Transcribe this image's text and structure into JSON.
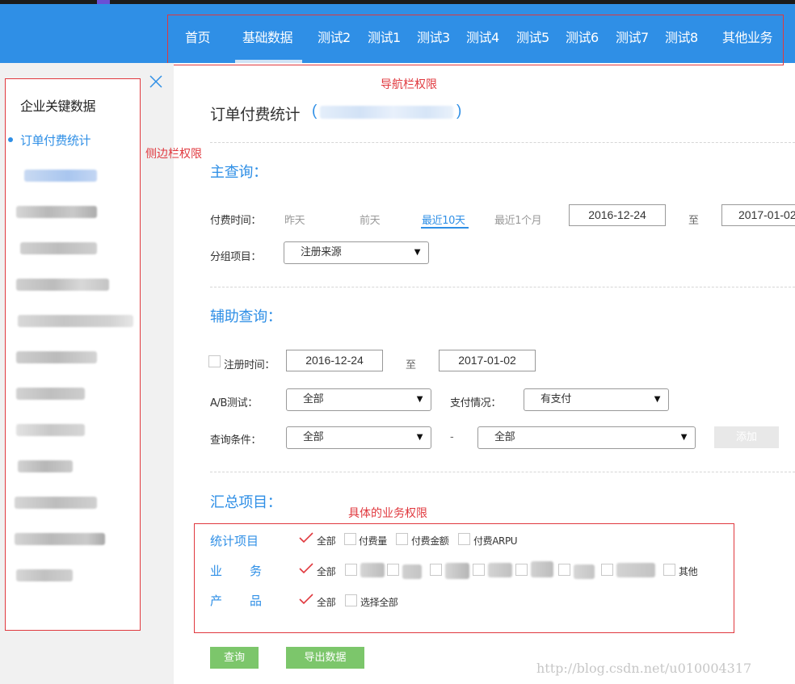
{
  "nav": {
    "items": [
      "首页",
      "基础数据",
      "测试2",
      "测试1",
      "测试3",
      "测试4",
      "测试5",
      "测试6",
      "测试7",
      "测试8",
      "其他业务"
    ],
    "active_index": 1
  },
  "annotations": {
    "nav": "导航栏权限",
    "sidebar": "侧边栏权限",
    "business": "具体的业务权限"
  },
  "sidebar": {
    "title": "企业关键数据",
    "active_item": "订单付费统计"
  },
  "page": {
    "title": "订单付费统计",
    "paren_open": "(",
    "paren_close": ")"
  },
  "main_query": {
    "title": "主查询：",
    "pay_time_label": "付费时间：",
    "quick_ranges": [
      "昨天",
      "前天",
      "最近10天",
      "最近1个月"
    ],
    "active_range": "最近10天",
    "start_date": "2016-12-24",
    "to": "至",
    "end_date": "2017-01-02",
    "group_label": "分组项目：",
    "group_value": "注册来源"
  },
  "aux_query": {
    "title": "辅助查询：",
    "reg_time_label": "注册时间：",
    "reg_start": "2016-12-24",
    "to": "至",
    "reg_end": "2017-01-02",
    "ab_label": "A/B测试：",
    "ab_value": "全部",
    "pay_status_label": "支付情况：",
    "pay_status_value": "有支付",
    "cond_label": "查询条件：",
    "cond_field": "全部",
    "dash": "-",
    "cond_value": "全部",
    "add_button": "添加"
  },
  "summary": {
    "title": "汇总项目：",
    "stat_label": "统计项目",
    "stat_options": [
      "全部",
      "付费量",
      "付费金额",
      "付费ARPU"
    ],
    "biz_label_1": "业",
    "biz_label_2": "务",
    "biz_all": "全部",
    "biz_other": "其他",
    "prod_label_1": "产",
    "prod_label_2": "品",
    "prod_all": "全部",
    "prod_select_all": "选择全部"
  },
  "buttons": {
    "query": "查询",
    "export": "导出数据"
  },
  "watermark": "http://blog.csdn.net/u010004317",
  "colors": {
    "nav_bg": "#2f8fe6",
    "accent": "#2f8fe6",
    "annotation": "#e0383e",
    "button_green": "#7cc66b"
  }
}
